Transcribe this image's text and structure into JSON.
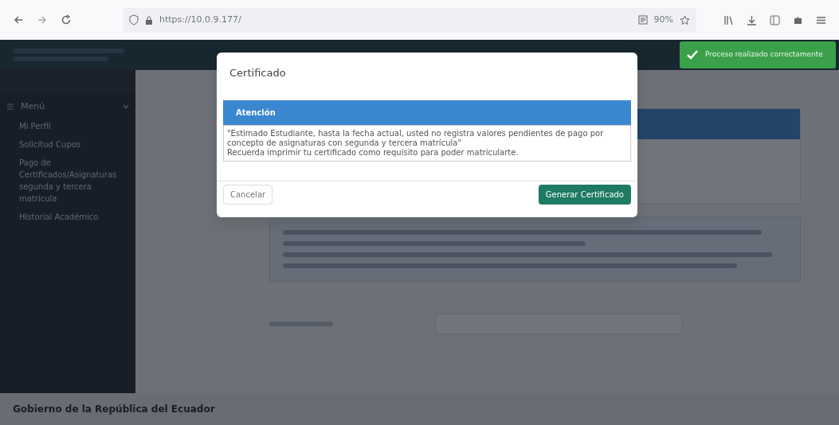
{
  "browser": {
    "url": "https://10.0.9.177/",
    "zoom": "90%"
  },
  "sidebar": {
    "items": [
      {
        "label": "Menú",
        "expanded": true,
        "children": [
          {
            "label": "Mi Perfil"
          },
          {
            "label": "Solicitud Cupos"
          },
          {
            "label": "Pago de Certificados/Asignaturas segunda y tercera matrícula"
          },
          {
            "label": "Historial Académico"
          }
        ]
      }
    ]
  },
  "modal": {
    "title": "Certificado",
    "alert_title": "Atención",
    "alert_paragraphs": [
      "\"Estimado Estudiante, hasta la fecha actual, usted no registra valores pendientes de pago por concepto de asignaturas con segunda y tercera matrícula\"",
      "Recuerda imprimir tu certificado como requisito para poder matricularte."
    ],
    "buttons": [
      {
        "label": "Cancelar",
        "kind": "secondary"
      },
      {
        "label": "Generar Certificado",
        "kind": "primary"
      }
    ]
  },
  "toast": {
    "message": "Proceso realizado correctamente"
  },
  "footer": {
    "text": "Gobierno de la República del Ecuador"
  }
}
